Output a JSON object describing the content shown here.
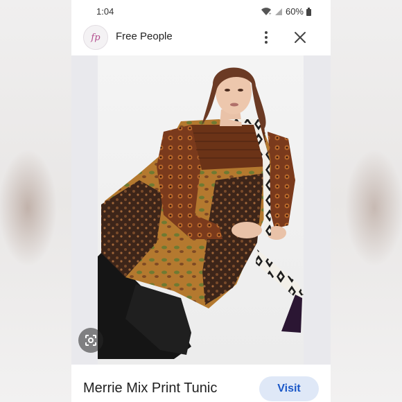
{
  "status_bar": {
    "time": "1:04",
    "battery": "60%"
  },
  "header": {
    "site_name": "Free People",
    "logo_text": "fp"
  },
  "icons": {
    "wifi": "wifi-icon",
    "signal": "signal-icon",
    "battery": "battery-icon",
    "more": "more-vert-icon",
    "close": "close-icon",
    "lens": "google-lens-icon"
  },
  "footer": {
    "product_title": "Merrie Mix Print Tunic",
    "visit_label": "Visit"
  },
  "colors": {
    "accent": "#1a57c8",
    "visit_bg": "#dfe8f7",
    "logo": "#b24a8c"
  }
}
